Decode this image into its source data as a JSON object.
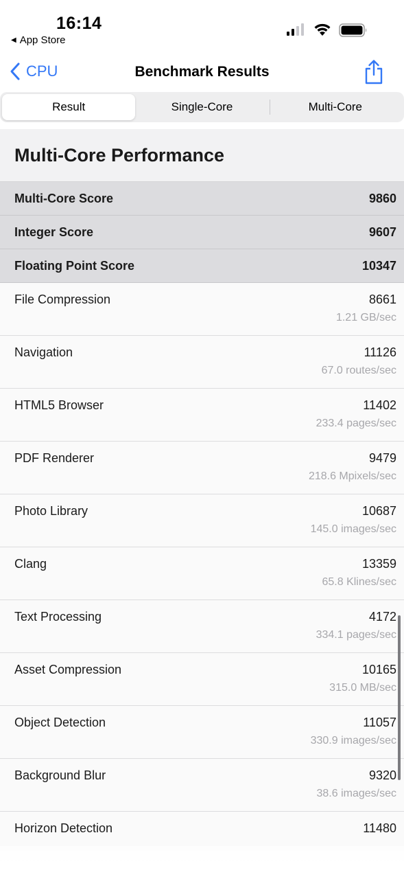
{
  "status_bar": {
    "time": "16:14",
    "back_app_label": "App Store"
  },
  "nav": {
    "back_label": "CPU",
    "title": "Benchmark Results"
  },
  "segments": [
    "Result",
    "Single-Core",
    "Multi-Core"
  ],
  "section": {
    "title": "Multi-Core Performance"
  },
  "scores": [
    {
      "label": "Multi-Core Score",
      "value": "9860"
    },
    {
      "label": "Integer Score",
      "value": "9607"
    },
    {
      "label": "Floating Point Score",
      "value": "10347"
    }
  ],
  "benchmarks": [
    {
      "name": "File Compression",
      "score": "8661",
      "rate": "1.21 GB/sec"
    },
    {
      "name": "Navigation",
      "score": "11126",
      "rate": "67.0 routes/sec"
    },
    {
      "name": "HTML5 Browser",
      "score": "11402",
      "rate": "233.4 pages/sec"
    },
    {
      "name": "PDF Renderer",
      "score": "9479",
      "rate": "218.6 Mpixels/sec"
    },
    {
      "name": "Photo Library",
      "score": "10687",
      "rate": "145.0 images/sec"
    },
    {
      "name": "Clang",
      "score": "13359",
      "rate": "65.8 Klines/sec"
    },
    {
      "name": "Text Processing",
      "score": "4172",
      "rate": "334.1 pages/sec"
    },
    {
      "name": "Asset Compression",
      "score": "10165",
      "rate": "315.0 MB/sec"
    },
    {
      "name": "Object Detection",
      "score": "11057",
      "rate": "330.9 images/sec"
    },
    {
      "name": "Background Blur",
      "score": "9320",
      "rate": "38.6 images/sec"
    },
    {
      "name": "Horizon Detection",
      "score": "11480",
      "rate": ""
    }
  ],
  "colors": {
    "accent": "#3478f6",
    "score_row_bg": "#dcdcdf",
    "rate_text": "#a7a7ab"
  }
}
